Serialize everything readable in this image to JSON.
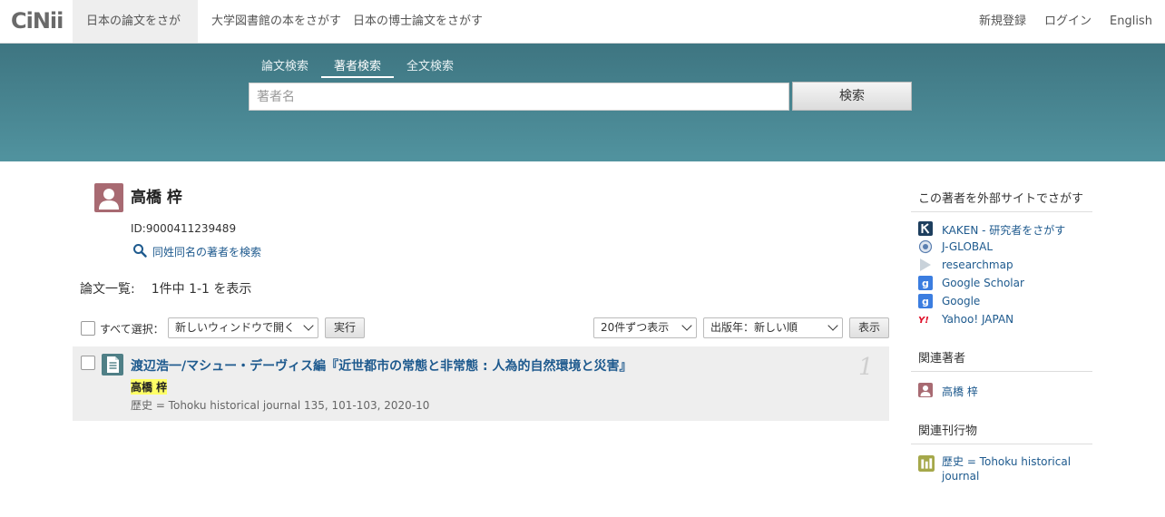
{
  "brand": {
    "logo_text": "CiNii"
  },
  "topnav": {
    "tabs": [
      "日本の論文をさがす",
      "大学図書館の本をさがす",
      "日本の博士論文をさがす"
    ],
    "right": [
      "新規登録",
      "ログイン",
      "English"
    ]
  },
  "search": {
    "tabs": [
      "論文検索",
      "著者検索",
      "全文検索"
    ],
    "active_tab": "著者検索",
    "placeholder": "著者名",
    "value": "",
    "button_label": "検索"
  },
  "author": {
    "name": "高橋 梓",
    "id_text": "ID:9000411239489",
    "same_name_search": "同姓同名の著者を検索"
  },
  "list": {
    "label": "論文一覧:",
    "count_text": "1件中 1-1 を表示",
    "select_all_label": "すべて選択：",
    "open_option": "新しいウィンドウで開く",
    "run_label": "実行",
    "per_page_option": "20件ずつ表示",
    "sort_option": "出版年：新しい順",
    "show_label": "表示"
  },
  "results": [
    {
      "title": "渡辺浩一/マシュー・デーヴィス編『近世都市の常態と非常態 : 人為的自然環境と災害』",
      "author": "高橋 梓",
      "source": "歴史 = Tohoku historical journal 135, 101-103, 2020-10",
      "index": "1"
    }
  ],
  "sidebar": {
    "external_heading": "この著者を外部サイトでさがす",
    "external_links": [
      {
        "label": "KAKEN - 研究者をさがす",
        "icon": "kaken-icon"
      },
      {
        "label": "J-GLOBAL",
        "icon": "jglobal-icon"
      },
      {
        "label": "researchmap",
        "icon": "researchmap-icon"
      },
      {
        "label": "Google Scholar",
        "icon": "google-scholar-icon"
      },
      {
        "label": "Google",
        "icon": "google-icon"
      },
      {
        "label": "Yahoo! JAPAN",
        "icon": "yahoo-icon"
      }
    ],
    "related_authors_heading": "関連著者",
    "related_authors": [
      "高橋 梓"
    ],
    "related_journals_heading": "関連刊行物",
    "related_journals": [
      "歴史 = Tohoku historical journal"
    ]
  },
  "colors": {
    "band_top": "#3e7581",
    "band_bottom": "#51939f",
    "link": "#1e5a8e",
    "highlight": "#ffff66"
  }
}
